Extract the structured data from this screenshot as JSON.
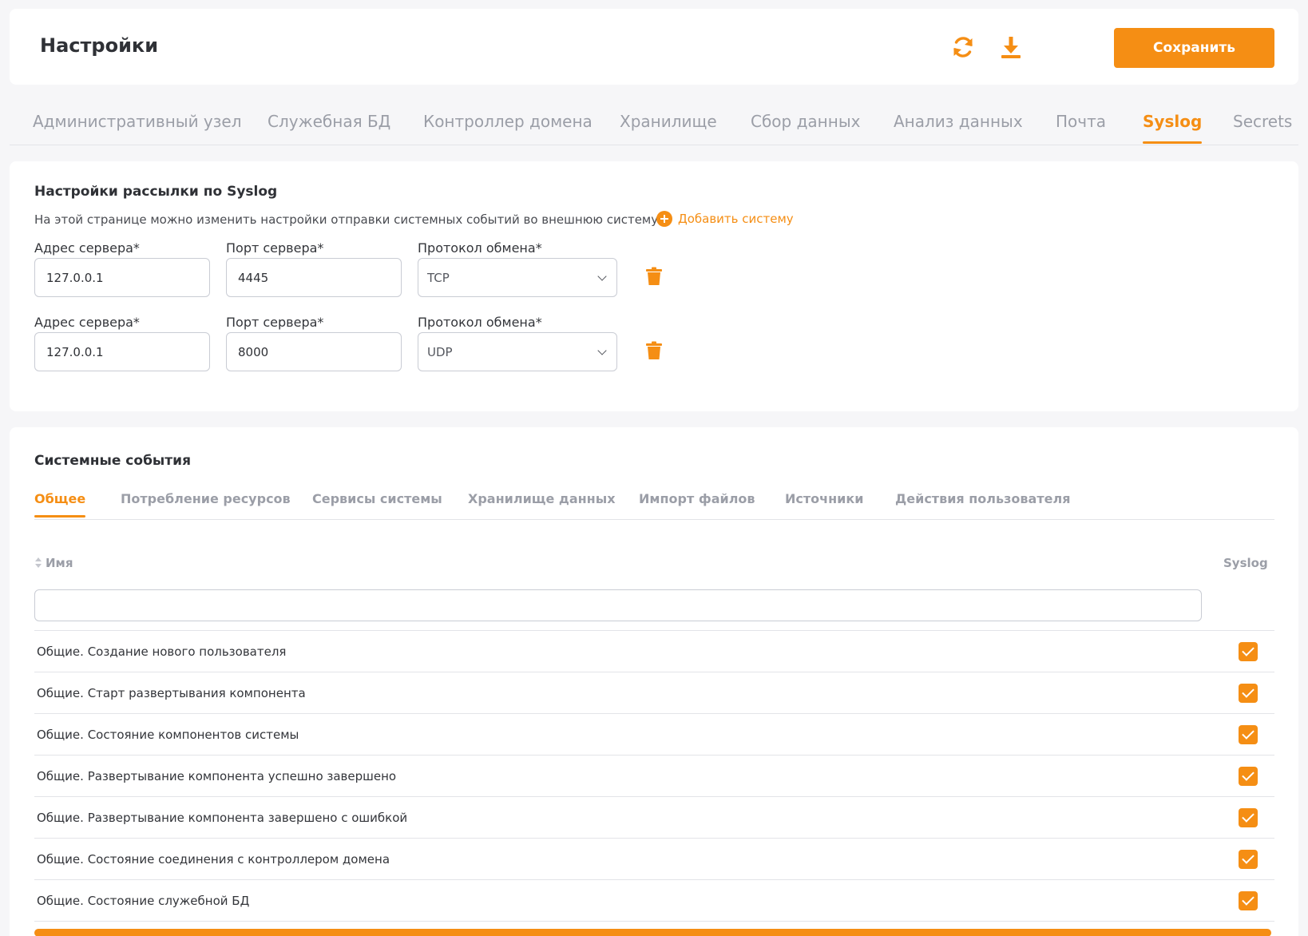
{
  "header": {
    "title": "Настройки",
    "save_label": "Сохранить",
    "icons": {
      "refresh": "refresh-icon",
      "download": "download-icon"
    }
  },
  "main_tabs": [
    {
      "label": "Административный узел",
      "active": false
    },
    {
      "label": "Служебная БД",
      "active": false
    },
    {
      "label": "Контроллер домена",
      "active": false
    },
    {
      "label": "Хранилище",
      "active": false
    },
    {
      "label": "Сбор данных",
      "active": false
    },
    {
      "label": "Анализ данных",
      "active": false
    },
    {
      "label": "Почта",
      "active": false
    },
    {
      "label": "Syslog",
      "active": true
    },
    {
      "label": "Secrets",
      "active": false
    }
  ],
  "syslog": {
    "title": "Настройки рассылки по Syslog",
    "description": "На этой странице можно изменить настройки отправки системных событий во внешнюю систему",
    "add_label": "Добавить систему",
    "address_label": "Адрес сервера*",
    "port_label": "Порт сервера*",
    "protocol_label": "Протокол обмена*",
    "servers": [
      {
        "address": "127.0.0.1",
        "port": "4445",
        "protocol": "TCP"
      },
      {
        "address": "127.0.0.1",
        "port": "8000",
        "protocol": "UDP"
      }
    ]
  },
  "events": {
    "title": "Системные события",
    "tabs": [
      {
        "label": "Общее",
        "active": true
      },
      {
        "label": "Потребление ресурсов",
        "active": false
      },
      {
        "label": "Сервисы системы",
        "active": false
      },
      {
        "label": "Хранилище данных",
        "active": false
      },
      {
        "label": "Импорт файлов",
        "active": false
      },
      {
        "label": "Источники",
        "active": false
      },
      {
        "label": "Действия пользователя",
        "active": false
      }
    ],
    "columns": {
      "name": "Имя",
      "syslog": "Syslog"
    },
    "filter_value": "",
    "rows": [
      {
        "name": "Общие. Создание нового пользователя",
        "syslog": true
      },
      {
        "name": "Общие. Старт развертывания компонента",
        "syslog": true
      },
      {
        "name": "Общие. Состояние компонентов системы",
        "syslog": true
      },
      {
        "name": "Общие. Развертывание компонента успешно завершено",
        "syslog": true
      },
      {
        "name": "Общие. Развертывание компонента завершено с ошибкой",
        "syslog": true
      },
      {
        "name": "Общие. Состояние соединения с контроллером домена",
        "syslog": true
      },
      {
        "name": "Общие. Состояние служебной БД",
        "syslog": true
      }
    ]
  },
  "colors": {
    "accent": "#f58e14",
    "text": "#33353a",
    "muted": "#9b9ea7"
  }
}
